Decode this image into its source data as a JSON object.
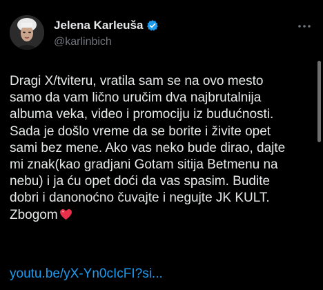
{
  "author": {
    "display_name": "Jelena Karleuša",
    "handle": "@karlinbich",
    "avatar_icon": "profile-photo",
    "verified_icon": "verified-badge-icon"
  },
  "tweet": {
    "lines": [
      "Dragi X/tviteru, vratila sam se na ovo mesto",
      "samo da vam lično uručim dva najbrutalnija",
      "albuma veka, video i promociju iz budućnosti.",
      "Sada je došlo vreme da se borite i živite opet",
      "sami bez mene. Ako vas neko bude dirao, dajte",
      "mi znak(kao gradjani Gotam sitija Betmenu na",
      "nebu) i ja ću opet doći da vas spasim. Budite",
      "dobri i danonoćno čuvajte i negujte JK KULT.",
      "Zbogom"
    ],
    "trailing_emoji": "red-heart-icon",
    "link_text": "youtu.be/yX-Yn0cIcFI?si..."
  },
  "colors": {
    "background": "#000000",
    "text": "#e7e9ea",
    "secondary_text": "#71767b",
    "link": "#1d9bf0",
    "verified": "#1d9bf0",
    "heart": "#e8304a"
  }
}
